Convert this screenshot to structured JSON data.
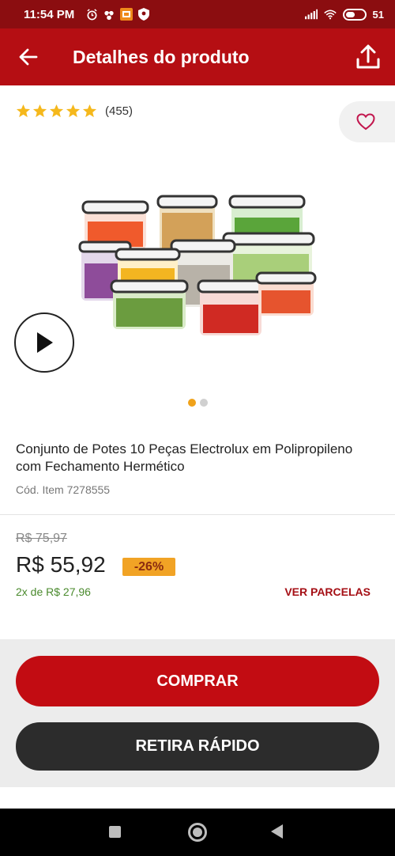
{
  "status_bar": {
    "time": "11:54 PM",
    "battery_percent": "51",
    "battery_level": 0.51,
    "icons": [
      "alarm-icon",
      "wind-icon",
      "app-notification-icon",
      "shield-icon",
      "signal-icon",
      "wifi-icon",
      "battery-icon"
    ]
  },
  "app_bar": {
    "title": "Detalhes do produto",
    "back_icon": "arrow-left-icon",
    "share_icon": "upload-icon"
  },
  "rating": {
    "stars": 5,
    "count": "(455)",
    "star_color": "#f5b81c"
  },
  "favorite_icon": "heart-icon",
  "media": {
    "play_icon": "play-icon",
    "carousel_total": 2,
    "carousel_active": 1
  },
  "product": {
    "name": "Conjunto de Potes 10 Peças Electrolux em Polipropileno com Fechamento Hermético",
    "code": "Cód. Item 7278555"
  },
  "pricing": {
    "old_price": "R$ 75,97",
    "price": "R$ 55,92",
    "discount": "-26%",
    "installments": "2x de R$ 27,96",
    "ver_parcelas": "VER PARCELAS"
  },
  "actions": {
    "comprar": "COMPRAR",
    "retira_rapido": "RETIRA RÁPIDO"
  },
  "colors": {
    "brand_red": "#b50e13",
    "status_red": "#8b0d10",
    "button_red": "#c20c12",
    "badge_orange": "#f1a325",
    "installment_green": "#4a8a2d",
    "dark_button": "#2c2c2c"
  },
  "nav": {
    "icons": [
      "recent-apps-icon",
      "home-icon",
      "back-icon"
    ]
  }
}
